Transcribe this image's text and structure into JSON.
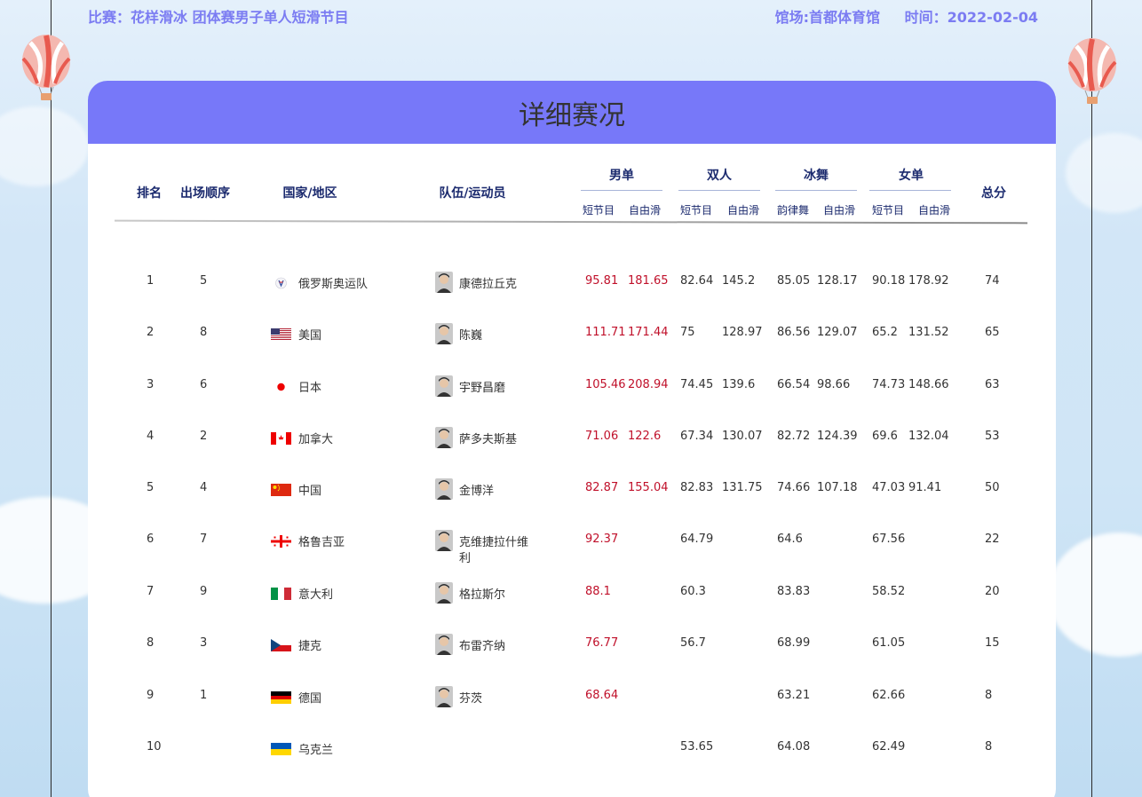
{
  "topbar": {
    "match_label": "比赛：花样滑冰 团体赛男子单人短滑节目",
    "venue_label": "馆场:首都体育馆",
    "time_label": "时间：2022-02-04"
  },
  "panel": {
    "title": "详细赛况"
  },
  "headers": {
    "rank": "排名",
    "order": "出场顺序",
    "country": "国家/地区",
    "athlete": "队伍/运动员",
    "total": "总分",
    "groups": [
      {
        "name": "男单",
        "sub1": "短节目",
        "sub2": "自由滑"
      },
      {
        "name": "双人",
        "sub1": "短节目",
        "sub2": "自由滑"
      },
      {
        "name": "冰舞",
        "sub1": "韵律舞",
        "sub2": "自由滑"
      },
      {
        "name": "女单",
        "sub1": "短节目",
        "sub2": "自由滑"
      }
    ]
  },
  "rows": [
    {
      "rank": "1",
      "order": "5",
      "country": "俄罗斯奥运队",
      "flag": "roc-flag",
      "athlete": "康德拉丘克",
      "avatar": "athlete-photo",
      "ms_sp": "95.81",
      "ms_fs": "181.65",
      "pr_sp": "82.64",
      "pr_fs": "145.2",
      "id_rd": "85.05",
      "id_fd": "128.17",
      "ls_sp": "90.18",
      "ls_fs": "178.92",
      "total": "74"
    },
    {
      "rank": "2",
      "order": "8",
      "country": "美国",
      "flag": "usa-flag",
      "athlete": "陈巍",
      "avatar": "athlete-photo",
      "ms_sp": "111.71",
      "ms_fs": "171.44",
      "pr_sp": "75",
      "pr_fs": "128.97",
      "id_rd": "86.56",
      "id_fd": "129.07",
      "ls_sp": "65.2",
      "ls_fs": "131.52",
      "total": "65"
    },
    {
      "rank": "3",
      "order": "6",
      "country": "日本",
      "flag": "japan-flag",
      "athlete": "宇野昌磨",
      "avatar": "athlete-photo",
      "ms_sp": "105.46",
      "ms_fs": "208.94",
      "pr_sp": "74.45",
      "pr_fs": "139.6",
      "id_rd": "66.54",
      "id_fd": "98.66",
      "ls_sp": "74.73",
      "ls_fs": "148.66",
      "total": "63"
    },
    {
      "rank": "4",
      "order": "2",
      "country": "加拿大",
      "flag": "canada-flag",
      "athlete": "萨多夫斯基",
      "avatar": "athlete-photo",
      "ms_sp": "71.06",
      "ms_fs": "122.6",
      "pr_sp": "67.34",
      "pr_fs": "130.07",
      "id_rd": "82.72",
      "id_fd": "124.39",
      "ls_sp": "69.6",
      "ls_fs": "132.04",
      "total": "53"
    },
    {
      "rank": "5",
      "order": "4",
      "country": "中国",
      "flag": "china-flag",
      "athlete": "金博洋",
      "avatar": "athlete-photo",
      "ms_sp": "82.87",
      "ms_fs": "155.04",
      "pr_sp": "82.83",
      "pr_fs": "131.75",
      "id_rd": "74.66",
      "id_fd": "107.18",
      "ls_sp": "47.03",
      "ls_fs": "91.41",
      "total": "50"
    },
    {
      "rank": "6",
      "order": "7",
      "country": "格鲁吉亚",
      "flag": "georgia-flag",
      "athlete": "克维捷拉什维",
      "athlete2": "利",
      "avatar": "athlete-photo",
      "ms_sp": "92.37",
      "ms_fs": "",
      "pr_sp": "64.79",
      "pr_fs": "",
      "id_rd": "64.6",
      "id_fd": "",
      "ls_sp": "67.56",
      "ls_fs": "",
      "total": "22"
    },
    {
      "rank": "7",
      "order": "9",
      "country": "意大利",
      "flag": "italy-flag",
      "athlete": "格拉斯尔",
      "avatar": "athlete-photo",
      "ms_sp": "88.1",
      "ms_fs": "",
      "pr_sp": "60.3",
      "pr_fs": "",
      "id_rd": "83.83",
      "id_fd": "",
      "ls_sp": "58.52",
      "ls_fs": "",
      "total": "20"
    },
    {
      "rank": "8",
      "order": "3",
      "country": "捷克",
      "flag": "czech-flag",
      "athlete": "布雷齐纳",
      "avatar": "athlete-photo",
      "ms_sp": "76.77",
      "ms_fs": "",
      "pr_sp": "56.7",
      "pr_fs": "",
      "id_rd": "68.99",
      "id_fd": "",
      "ls_sp": "61.05",
      "ls_fs": "",
      "total": "15"
    },
    {
      "rank": "9",
      "order": "1",
      "country": "德国",
      "flag": "germany-flag",
      "athlete": "芬茨",
      "avatar": "athlete-photo",
      "ms_sp": "68.64",
      "ms_fs": "",
      "pr_sp": "",
      "pr_fs": "",
      "id_rd": "63.21",
      "id_fd": "",
      "ls_sp": "62.66",
      "ls_fs": "",
      "total": "8"
    },
    {
      "rank": "10",
      "order": "",
      "country": "乌克兰",
      "flag": "ukraine-flag",
      "athlete": "",
      "avatar": "",
      "ms_sp": "",
      "ms_fs": "",
      "pr_sp": "53.65",
      "pr_fs": "",
      "id_rd": "64.08",
      "id_fd": "",
      "ls_sp": "62.49",
      "ls_fs": "",
      "total": "8"
    }
  ],
  "colors": {
    "accent": "#7778f9",
    "topbar_text": "#7b7cf2",
    "header_text": "#1b2a6e",
    "men_score": "#c0102a"
  }
}
